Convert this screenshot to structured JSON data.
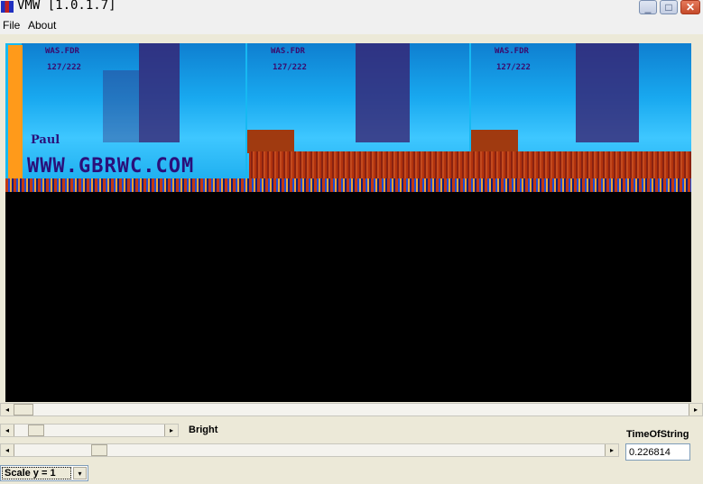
{
  "window": {
    "title": "VMW [1.0.1.7]",
    "minimize_glyph": "_",
    "maximize_glyph": "□",
    "close_glyph": "✕"
  },
  "menu": {
    "file": "File",
    "about": "About"
  },
  "viewer": {
    "overlay_title": "WAS.FDR",
    "overlay_code": "127/222",
    "paul_label": "Paul",
    "watermark": "WWW.GBRWC.COM"
  },
  "controls": {
    "bright_label": "Bright",
    "time_label": "TimeOfString",
    "time_value": "0.226814",
    "scale_value": "Scale y = 1"
  },
  "icons": {
    "left_arrow": "◂",
    "right_arrow": "▸",
    "down_arrow": "▾"
  },
  "colors": {
    "image_blue": "#16b9f2",
    "image_red": "#b2330e",
    "image_orange": "#ff9a1a"
  }
}
